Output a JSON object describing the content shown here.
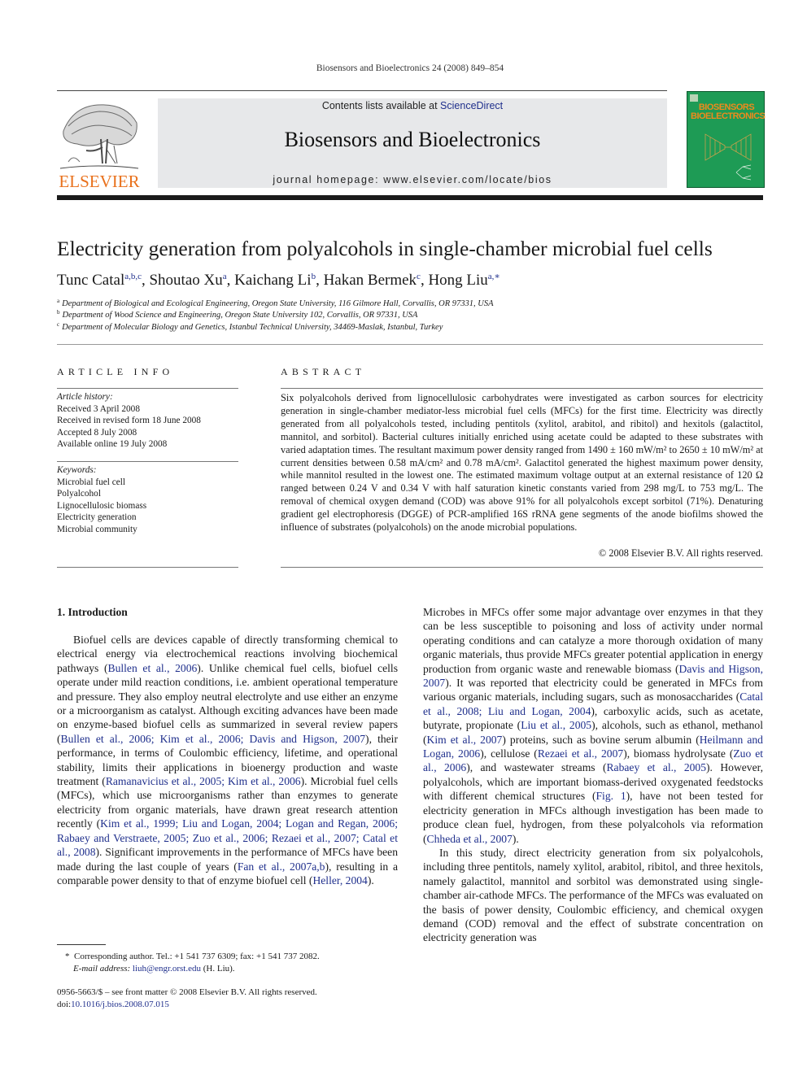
{
  "running_head": "Biosensors and Bioelectronics 24 (2008) 849–854",
  "masthead": {
    "publisher_logo": "ELSEVIER",
    "contents_prefix": "Contents lists available at ",
    "contents_link": "ScienceDirect",
    "journal_name": "Biosensors and Bioelectronics",
    "homepage": "journal homepage: www.elsevier.com/locate/bios",
    "cover_title_line1": "BIOSENSORS",
    "cover_title_line2": "BIOELECTRONICS",
    "colors": {
      "elsevier_orange": "#e9711c",
      "cover_green": "#1e9b55",
      "link_blue": "#1f2f8c",
      "banner_gray": "#e7e8ea"
    }
  },
  "article": {
    "title": "Electricity generation from polyalcohols in single-chamber microbial fuel cells",
    "authors": [
      {
        "name": "Tunc Catal",
        "sup": "a,b,c"
      },
      {
        "name": "Shoutao Xu",
        "sup": "a"
      },
      {
        "name": "Kaichang Li",
        "sup": "b"
      },
      {
        "name": "Hakan Bermek",
        "sup": "c"
      },
      {
        "name": "Hong Liu",
        "sup": "a,∗"
      }
    ],
    "affiliations": [
      {
        "mark": "a",
        "text": "Department of Biological and Ecological Engineering, Oregon State University, 116 Gilmore Hall, Corvallis, OR 97331, USA"
      },
      {
        "mark": "b",
        "text": "Department of Wood Science and Engineering, Oregon State University 102, Corvallis, OR 97331, USA"
      },
      {
        "mark": "c",
        "text": "Department of Molecular Biology and Genetics, Istanbul Technical University, 34469-Maslak, Istanbul, Turkey"
      }
    ]
  },
  "article_info": {
    "heading": "ARTICLE INFO",
    "history_label": "Article history:",
    "history": [
      "Received 3 April 2008",
      "Received in revised form 18 June 2008",
      "Accepted 8 July 2008",
      "Available online 19 July 2008"
    ],
    "keywords_label": "Keywords:",
    "keywords": [
      "Microbial fuel cell",
      "Polyalcohol",
      "Lignocellulosic biomass",
      "Electricity generation",
      "Microbial community"
    ]
  },
  "abstract": {
    "heading": "ABSTRACT",
    "text": "Six polyalcohols derived from lignocellulosic carbohydrates were investigated as carbon sources for electricity generation in single-chamber mediator-less microbial fuel cells (MFCs) for the first time. Electricity was directly generated from all polyalcohols tested, including pentitols (xylitol, arabitol, and ribitol) and hexitols (galactitol, mannitol, and sorbitol). Bacterial cultures initially enriched using acetate could be adapted to these substrates with varied adaptation times. The resultant maximum power density ranged from 1490 ± 160 mW/m² to 2650 ± 10 mW/m² at current densities between 0.58 mA/cm² and 0.78 mA/cm². Galactitol generated the highest maximum power density, while mannitol resulted in the lowest one. The estimated maximum voltage output at an external resistance of 120 Ω ranged between 0.24 V and 0.34 V with half saturation kinetic constants varied from 298 mg/L to 753 mg/L. The removal of chemical oxygen demand (COD) was above 91% for all polyalcohols except sorbitol (71%). Denaturing gradient gel electrophoresis (DGGE) of PCR-amplified 16S rRNA gene segments of the anode biofilms showed the influence of substrates (polyalcohols) on the anode microbial populations.",
    "copyright": "© 2008 Elsevier B.V. All rights reserved."
  },
  "introduction": {
    "heading": "1.  Introduction",
    "left_paragraph": [
      {
        "t": "Biofuel cells are devices capable of directly transforming chemical to electrical energy via electrochemical reactions involving biochemical pathways ("
      },
      {
        "l": "Bullen et al., 2006"
      },
      {
        "t": "). Unlike chemical fuel cells, biofuel cells operate under mild reaction conditions, i.e. ambient operational temperature and pressure. They also employ neutral electrolyte and use either an enzyme or a microorganism as catalyst. Although exciting advances have been made on enzyme-based biofuel cells as summarized in several review papers ("
      },
      {
        "l": "Bullen et al., 2006; Kim et al., 2006; Davis and Higson, 2007"
      },
      {
        "t": "), their performance, in terms of Coulombic efficiency, lifetime, and operational stability, limits their applications in bioenergy production and waste treatment ("
      },
      {
        "l": "Ramanavicius et al., 2005; Kim et al., 2006"
      },
      {
        "t": "). Microbial fuel cells (MFCs), which use microorganisms rather than enzymes to generate electricity from organic materials, have drawn great research attention recently ("
      },
      {
        "l": "Kim et al., 1999; Liu and Logan, 2004; Logan and Regan, 2006; Rabaey and Verstraete, 2005; Zuo et al., 2006; Rezaei et al., 2007; Catal et al., 2008"
      },
      {
        "t": "). Significant improvements in the performance of MFCs have been made during the last couple of years ("
      },
      {
        "l": "Fan et al., 2007a,b"
      },
      {
        "t": "), resulting in a comparable power density to that of enzyme biofuel cell ("
      },
      {
        "l": "Heller, 2004"
      },
      {
        "t": ")."
      }
    ],
    "right_paragraph_1": [
      {
        "t": "Microbes in MFCs offer some major advantage over enzymes in that they can be less susceptible to poisoning and loss of activity under normal operating conditions and can catalyze a more thorough oxidation of many organic materials, thus provide MFCs greater potential application in energy production from organic waste and renewable biomass ("
      },
      {
        "l": "Davis and Higson, 2007"
      },
      {
        "t": "). It was reported that electricity could be generated in MFCs from various organic materials, including sugars, such as monosaccharides ("
      },
      {
        "l": "Catal et al., 2008; Liu and Logan, 2004"
      },
      {
        "t": "), carboxylic acids, such as acetate, butyrate, propionate ("
      },
      {
        "l": "Liu et al., 2005"
      },
      {
        "t": "), alcohols, such as ethanol, methanol ("
      },
      {
        "l": "Kim et al., 2007"
      },
      {
        "t": ") proteins, such as bovine serum albumin ("
      },
      {
        "l": "Heilmann and Logan, 2006"
      },
      {
        "t": "), cellulose ("
      },
      {
        "l": "Rezaei et al., 2007"
      },
      {
        "t": "), biomass hydrolysate ("
      },
      {
        "l": "Zuo et al., 2006"
      },
      {
        "t": "), and wastewater streams ("
      },
      {
        "l": "Rabaey et al., 2005"
      },
      {
        "t": "). However, polyalcohols, which are important biomass-derived oxygenated feedstocks with different chemical structures ("
      },
      {
        "l": "Fig. 1"
      },
      {
        "t": "), have not been tested for electricity generation in MFCs although investigation has been made to produce clean fuel, hydrogen, from these polyalcohols via reformation ("
      },
      {
        "l": "Chheda et al., 2007"
      },
      {
        "t": ")."
      }
    ],
    "right_paragraph_2": [
      {
        "t": "In this study, direct electricity generation from six polyalcohols, including three pentitols, namely xylitol, arabitol, ribitol, and three hexitols, namely galactitol, mannitol and sorbitol was demonstrated using single-chamber air-cathode MFCs. The performance of the MFCs was evaluated on the basis of power density, Coulombic efficiency, and chemical oxygen demand (COD) removal and the effect of substrate concentration on electricity generation was"
      }
    ]
  },
  "footnote": {
    "star": "*",
    "corresponding": "Corresponding author. Tel.: +1 541 737 6309; fax: +1 541 737 2082.",
    "email_label": "E-mail address:",
    "email": "liuh@engr.orst.edu",
    "email_suffix": " (H. Liu)."
  },
  "front_matter": {
    "issn_line": "0956-5663/$ – see front matter © 2008 Elsevier B.V. All rights reserved.",
    "doi_prefix": "doi:",
    "doi": "10.1016/j.bios.2008.07.015"
  }
}
